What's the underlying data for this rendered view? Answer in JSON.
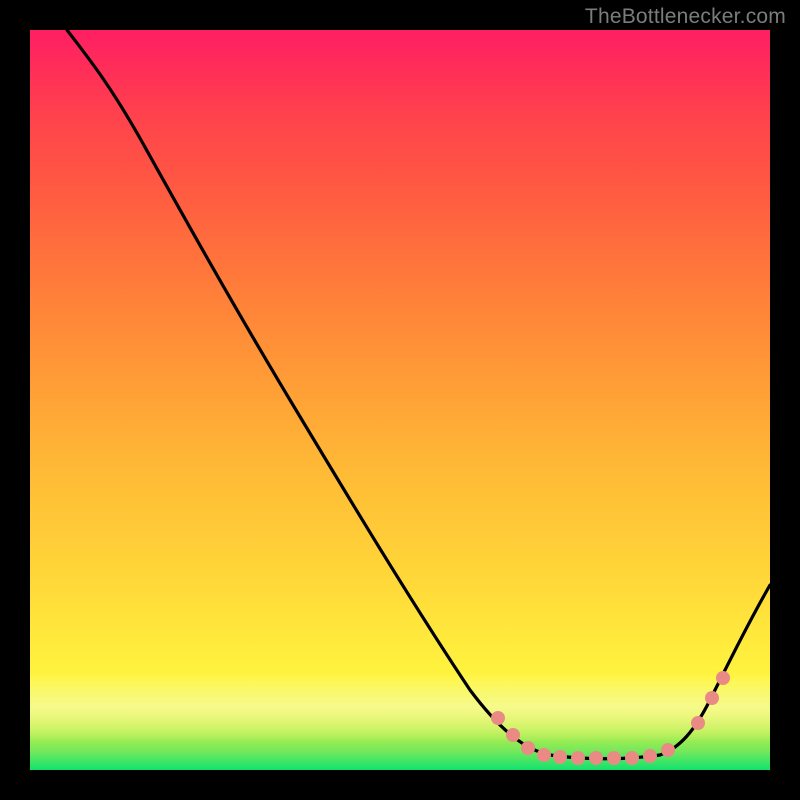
{
  "attribution": "TheBottlenecker.com",
  "chart_data": {
    "type": "line",
    "title": "",
    "xlabel": "",
    "ylabel": "",
    "xlim": [
      0,
      100
    ],
    "ylim": [
      0,
      100
    ],
    "x": [
      5,
      10,
      15,
      20,
      25,
      30,
      35,
      40,
      45,
      50,
      55,
      60,
      65,
      70,
      72,
      75,
      78,
      80,
      83,
      85,
      88,
      90,
      95,
      100
    ],
    "y": [
      100,
      96,
      91,
      84,
      76,
      68,
      60,
      52,
      44,
      36,
      28,
      20,
      12,
      5,
      3,
      2,
      2,
      2,
      2,
      2,
      3,
      6,
      15,
      24
    ],
    "series": [
      {
        "name": "bottleneck-curve",
        "x": [
          5,
          10,
          15,
          20,
          25,
          30,
          35,
          40,
          45,
          50,
          55,
          60,
          65,
          70,
          72,
          75,
          78,
          80,
          83,
          85,
          88,
          90,
          95,
          100
        ],
        "y": [
          100,
          96,
          91,
          84,
          76,
          68,
          60,
          52,
          44,
          36,
          28,
          20,
          12,
          5,
          3,
          2,
          2,
          2,
          2,
          2,
          3,
          6,
          15,
          24
        ]
      }
    ],
    "markers": {
      "x": [
        67,
        69,
        71,
        73,
        75,
        77,
        79,
        81,
        83,
        85,
        87,
        89,
        91,
        93
      ],
      "y": [
        8,
        5,
        3,
        2,
        2,
        2,
        2,
        2,
        2,
        2,
        3,
        5,
        8,
        12
      ]
    },
    "gradient_stops": [
      {
        "pos": 0.0,
        "color": "#12e26f"
      },
      {
        "pos": 0.1,
        "color": "#fff53e"
      },
      {
        "pos": 0.5,
        "color": "#ffa836"
      },
      {
        "pos": 1.0,
        "color": "#ff1e63"
      }
    ]
  }
}
